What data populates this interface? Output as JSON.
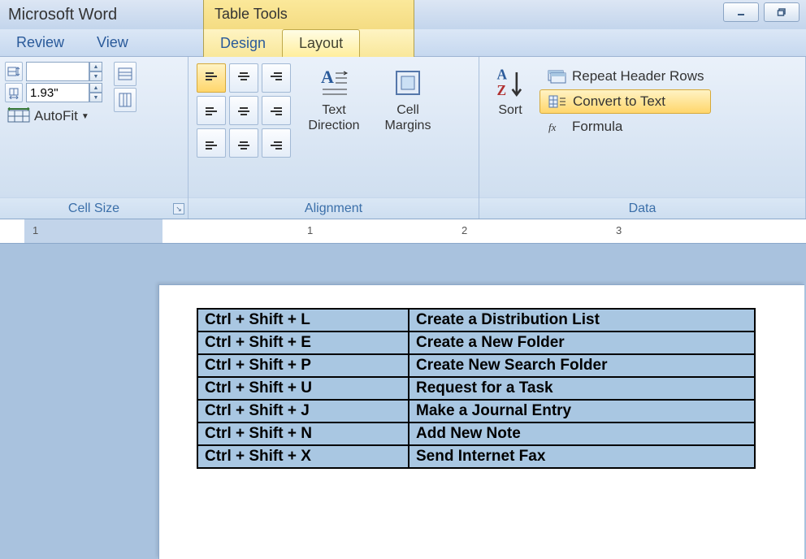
{
  "titlebar": {
    "app_name": "Microsoft Word",
    "context_tab": "Table Tools"
  },
  "tabs": {
    "review": "Review",
    "view": "View",
    "design": "Design",
    "layout": "Layout"
  },
  "ribbon": {
    "cell_size": {
      "label": "Cell Size",
      "height_value": "",
      "width_value": "1.93\"",
      "autofit": "AutoFit"
    },
    "alignment": {
      "label": "Alignment",
      "text_direction": "Text Direction",
      "cell_margins": "Cell Margins"
    },
    "sort_group": {
      "sort": "Sort",
      "repeat_header": "Repeat Header Rows",
      "convert_to_text": "Convert to Text",
      "formula": "Formula",
      "label": "Data"
    }
  },
  "ruler": {
    "marks": [
      "1",
      "1",
      "2",
      "3"
    ]
  },
  "table_data": [
    {
      "shortcut": "Ctrl + Shift + L",
      "action": "Create a Distribution List"
    },
    {
      "shortcut": "Ctrl + Shift + E",
      "action": "Create a New Folder"
    },
    {
      "shortcut": "Ctrl + Shift + P",
      "action": "Create New Search Folder"
    },
    {
      "shortcut": "Ctrl + Shift + U",
      "action": "Request for a Task"
    },
    {
      "shortcut": "Ctrl + Shift + J",
      "action": "Make a Journal Entry"
    },
    {
      "shortcut": "Ctrl + Shift + N",
      "action": "Add New Note"
    },
    {
      "shortcut": "Ctrl + Shift + X",
      "action": "Send Internet Fax"
    }
  ]
}
